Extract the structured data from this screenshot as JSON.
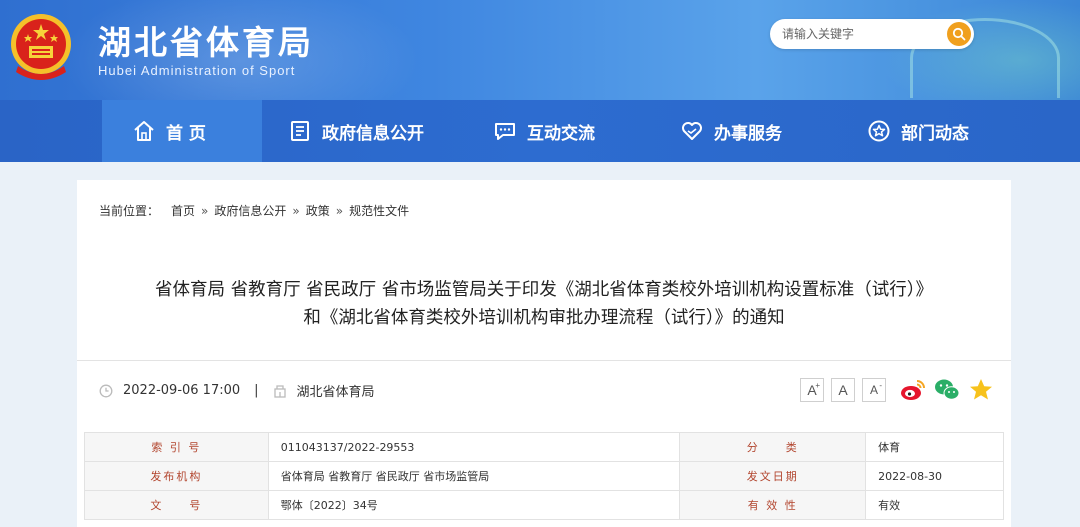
{
  "site": {
    "title": "湖北省体育局",
    "subtitle": "Hubei Administration of Sport",
    "search_placeholder": "请输入关键字"
  },
  "nav": {
    "items": [
      {
        "label": "首 页",
        "icon": "home-icon"
      },
      {
        "label": "政府信息公开",
        "icon": "document-icon"
      },
      {
        "label": "互动交流",
        "icon": "chat-icon"
      },
      {
        "label": "办事服务",
        "icon": "heart-hand-icon"
      },
      {
        "label": "部门动态",
        "icon": "star-circle-icon"
      }
    ],
    "active_index": 0
  },
  "breadcrumb": {
    "prefix": "当前位置：",
    "items": [
      "首页",
      "政府信息公开",
      "政策",
      "规范性文件"
    ],
    "separator": "»"
  },
  "document": {
    "title_line1": "省体育局 省教育厅 省民政厅 省市场监管局关于印发《湖北省体育类校外培训机构设置标准（试行）》",
    "title_line2": "和《湖北省体育类校外培训机构审批办理流程（试行）》的通知",
    "datetime": "2022-09-06 17:00",
    "meta_sep": "|",
    "source": "湖北省体育局"
  },
  "tools": {
    "font_large": "A",
    "font_medium": "A",
    "font_small": "A",
    "share": [
      "weibo-icon",
      "wechat-icon",
      "favorite-star-icon"
    ]
  },
  "info_table": {
    "rows": [
      {
        "k1": "索 引 号",
        "v1": "011043137/2022-29553",
        "k2": "分　　类",
        "v2": "体育"
      },
      {
        "k1": "发布机构",
        "v1": "省体育局 省教育厅 省民政厅 省市场监管局",
        "k2": "发文日期",
        "v2": "2022-08-30"
      },
      {
        "k1": "文　　号",
        "v1": "鄂体〔2022〕34号",
        "k2": "有 效 性",
        "v2": "有效"
      }
    ]
  },
  "colors": {
    "header_blue": "#2f6fd0",
    "nav_blue": "#2a64c6",
    "nav_active": "#3b80dd",
    "search_button": "#f0a01e",
    "table_key_text": "#b2452e"
  }
}
